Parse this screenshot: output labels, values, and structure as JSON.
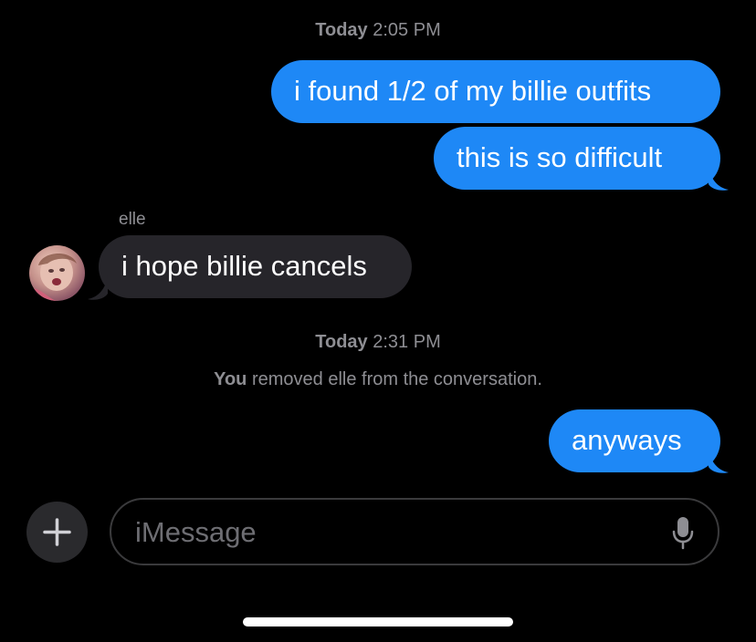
{
  "timestamps": [
    {
      "day": "Today",
      "time": "2:05 PM"
    },
    {
      "day": "Today",
      "time": "2:31 PM"
    }
  ],
  "messages": [
    {
      "text": "i found 1/2 of my billie outfits",
      "direction": "outgoing"
    },
    {
      "text": "this is so difficult",
      "direction": "outgoing"
    },
    {
      "text": "i hope billie cancels",
      "direction": "incoming",
      "sender": "elle"
    },
    {
      "text": "anyways",
      "direction": "outgoing"
    }
  ],
  "system_notice": {
    "actor": "You",
    "text": "removed elle from the conversation."
  },
  "composer": {
    "placeholder": "iMessage",
    "plus_icon": "plus-icon",
    "mic_icon": "microphone-icon"
  },
  "colors": {
    "outgoing_bubble": "#1e88f6",
    "incoming_bubble": "#26252a",
    "background": "#000000",
    "meta_text": "#8e8e93"
  }
}
